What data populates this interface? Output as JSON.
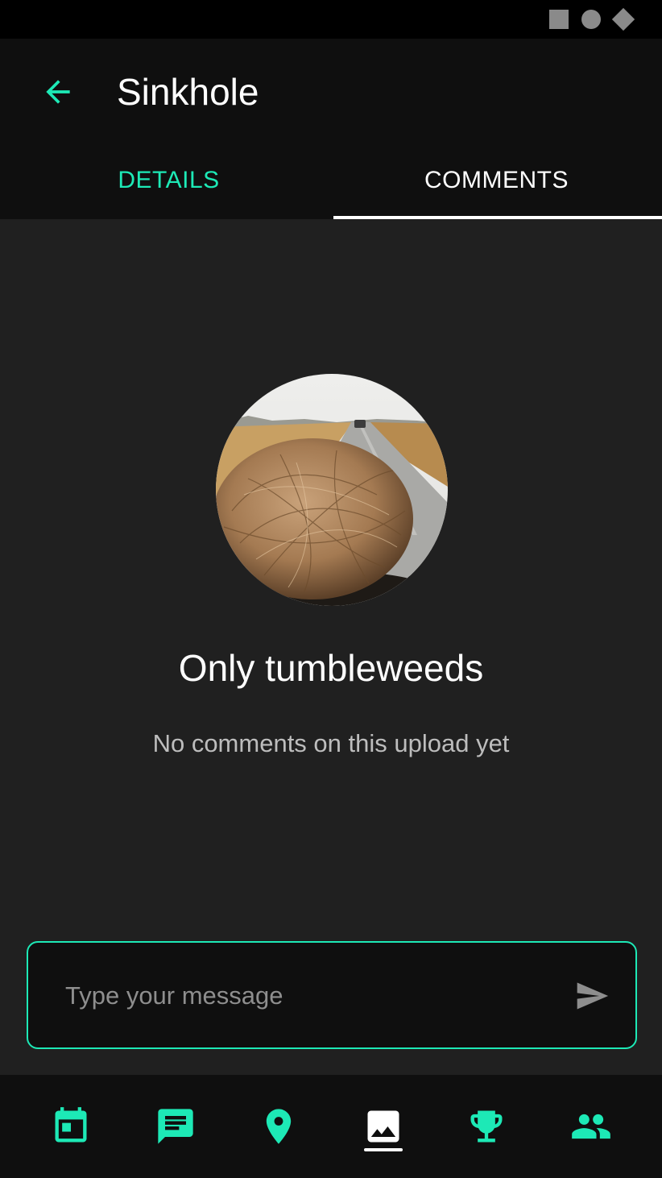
{
  "app_bar": {
    "title": "Sinkhole",
    "back_icon": "arrow-back-icon"
  },
  "tabs": [
    {
      "label": "DETAILS",
      "selected": false
    },
    {
      "label": "COMMENTS",
      "selected": true
    }
  ],
  "empty_state": {
    "image": "tumbleweed-photo",
    "title": "Only tumbleweeds",
    "subtitle": "No comments on this upload yet"
  },
  "composer": {
    "placeholder": "Type your message",
    "value": "",
    "send_icon": "send-icon"
  },
  "bottom_nav": [
    {
      "icon": "calendar-icon",
      "selected": false
    },
    {
      "icon": "chat-icon",
      "selected": false
    },
    {
      "icon": "location-pin-icon",
      "selected": false
    },
    {
      "icon": "image-icon",
      "selected": true
    },
    {
      "icon": "trophy-icon",
      "selected": false
    },
    {
      "icon": "people-icon",
      "selected": false
    }
  ],
  "colors": {
    "accent": "#1de9b6",
    "background": "#202020",
    "surface": "#0f0f0f",
    "text_primary": "#ffffff",
    "text_secondary": "#bdbdbd"
  }
}
